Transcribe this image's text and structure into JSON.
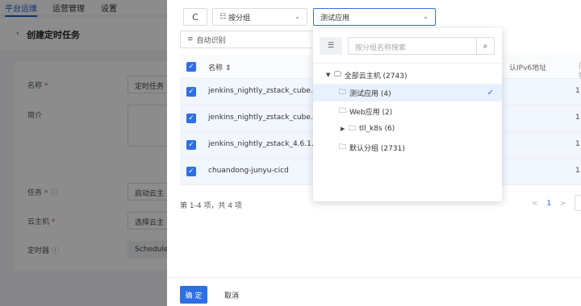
{
  "topnav": {
    "items": [
      "平台运维",
      "运营管理",
      "设置"
    ]
  },
  "page": {
    "back": "‹",
    "title": "创建定时任务"
  },
  "form": {
    "name_label": "名称",
    "name_value": "定时任务",
    "desc_label": "简介",
    "task_label": "任务",
    "task_value": "启动云主",
    "vm_label": "云主机",
    "vm_value": "选择云主",
    "timer_label": "定时器",
    "timer_value": "Schedule",
    "required_mark": "*",
    "info_icon": "ⓘ"
  },
  "toolbar": {
    "refresh_icon": "C",
    "group_by_icon": "☷",
    "group_by_label": "按分组",
    "app_selected": "测试应用",
    "filter_label": "自动识别"
  },
  "table": {
    "col_name": "名称 ⇕",
    "col_ipv6": "认IPv6地址",
    "col_sep": "|  物",
    "rows": [
      {
        "name": "jenkins_nightly_zstack_cube.",
        "value": "1"
      },
      {
        "name": "jenkins_nightly_zstack_cube.",
        "value": "1"
      },
      {
        "name": "jenkins_nightly_zstack_4.6.1.",
        "value": "1"
      },
      {
        "name": "chuandong-junyu-cicd",
        "value": "1"
      }
    ],
    "pager_info": "第 1-4 项，共 4 项",
    "pager_prev": "<",
    "pager_page": "1",
    "pager_next": ">"
  },
  "dropdown": {
    "search_placeholder": "按分组名称搜索",
    "nodes": [
      {
        "label": "全部云主机 (2743)"
      },
      {
        "label": "测试应用 (4)"
      },
      {
        "label": "Web应用 (2)"
      },
      {
        "label": "tll_k8s (6)"
      },
      {
        "label": "默认分组 (2731)"
      }
    ]
  },
  "footer": {
    "ok": "确 定",
    "cancel": "取消"
  },
  "colors": {
    "primary": "#2f6fe4",
    "selected_bg": "#e8f1ff",
    "required": "#e04a4a"
  }
}
